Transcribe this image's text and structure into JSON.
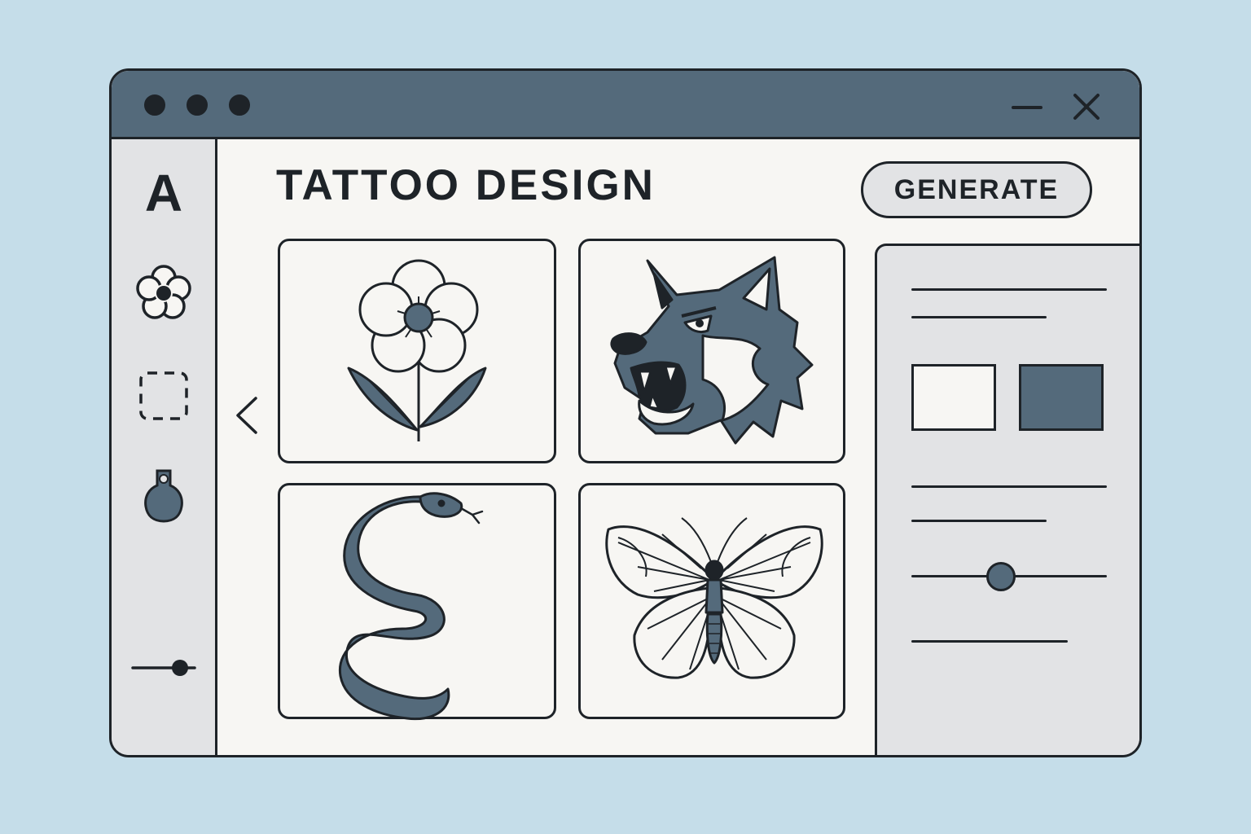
{
  "window": {
    "controls": [
      "close-dot",
      "minimize-dot",
      "zoom-dot"
    ],
    "actions": {
      "minimize_icon": "minus-icon",
      "close_icon": "x-icon"
    }
  },
  "sidebar": {
    "items": [
      {
        "label": "A",
        "icon": "text-tool"
      },
      {
        "icon": "flower-icon"
      },
      {
        "icon": "selection-icon"
      },
      {
        "icon": "ink-drop-icon"
      },
      {
        "icon": "slider-icon"
      }
    ]
  },
  "header": {
    "title": "TATTOO DESIGN",
    "generate_label": "GENERATE"
  },
  "gallery": {
    "back_icon": "chevron-left-icon",
    "designs": [
      {
        "subject": "flower"
      },
      {
        "subject": "wolf"
      },
      {
        "subject": "snake"
      },
      {
        "subject": "butterfly"
      }
    ]
  },
  "settings_panel": {
    "swatches": [
      {
        "name": "white",
        "color": "#f7f6f3"
      },
      {
        "name": "slate",
        "color": "#546a7b"
      }
    ],
    "slider_value": 0.46
  },
  "colors": {
    "background": "#c5dde9",
    "accent": "#546a7b",
    "ink": "#1e2328",
    "surface": "#f7f6f3",
    "panel": "#e2e3e5"
  }
}
